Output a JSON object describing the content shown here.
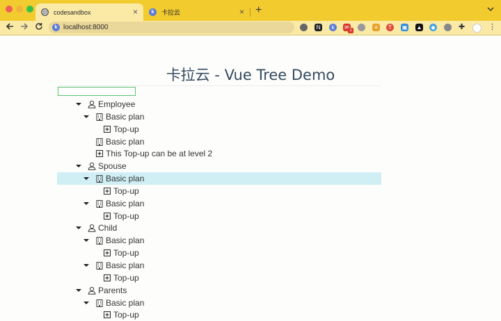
{
  "browser": {
    "tabs": [
      {
        "label": "codesandbox",
        "icon": "globe-icon",
        "active": true
      },
      {
        "label": "卡拉云",
        "icon": "kalayun-favicon-icon",
        "active": false
      }
    ],
    "new_tab": "+",
    "tab_menu": "⌄",
    "url": "localhost:8000",
    "colors": {
      "tabbar": "#f2cb2f",
      "toolbar": "#fbe9a6"
    },
    "mail_badge": "1"
  },
  "page": {
    "title": "卡拉云 - Vue Tree Demo",
    "filter_value": "",
    "selection_color": "#cfeff5"
  },
  "tree": [
    {
      "label": "Employee",
      "icon": "user-icon",
      "level": 1,
      "expandable": true
    },
    {
      "label": "Basic plan",
      "icon": "building-icon",
      "level": 2,
      "expandable": true
    },
    {
      "label": "Top-up",
      "icon": "plus-square-icon",
      "level": 3,
      "expandable": false
    },
    {
      "label": "Basic plan",
      "icon": "building-icon",
      "level": 2,
      "expandable": false
    },
    {
      "label": "This Top-up can be at level 2",
      "icon": "plus-square-icon",
      "level": 2,
      "expandable": false
    },
    {
      "label": "Spouse",
      "icon": "user-icon",
      "level": 1,
      "expandable": true
    },
    {
      "label": "Basic plan",
      "icon": "building-icon",
      "level": 2,
      "expandable": true,
      "selected": true
    },
    {
      "label": "Top-up",
      "icon": "plus-square-icon",
      "level": 3,
      "expandable": false
    },
    {
      "label": "Basic plan",
      "icon": "building-icon",
      "level": 2,
      "expandable": true
    },
    {
      "label": "Top-up",
      "icon": "plus-square-icon",
      "level": 3,
      "expandable": false
    },
    {
      "label": "Child",
      "icon": "user-icon",
      "level": 1,
      "expandable": true
    },
    {
      "label": "Basic plan",
      "icon": "building-icon",
      "level": 2,
      "expandable": true
    },
    {
      "label": "Top-up",
      "icon": "plus-square-icon",
      "level": 3,
      "expandable": false
    },
    {
      "label": "Basic plan",
      "icon": "building-icon",
      "level": 2,
      "expandable": true
    },
    {
      "label": "Top-up",
      "icon": "plus-square-icon",
      "level": 3,
      "expandable": false
    },
    {
      "label": "Parents",
      "icon": "user-icon",
      "level": 1,
      "expandable": true
    },
    {
      "label": "Basic plan",
      "icon": "building-icon",
      "level": 2,
      "expandable": true
    },
    {
      "label": "Top-up",
      "icon": "plus-square-icon",
      "level": 3,
      "expandable": false
    }
  ]
}
